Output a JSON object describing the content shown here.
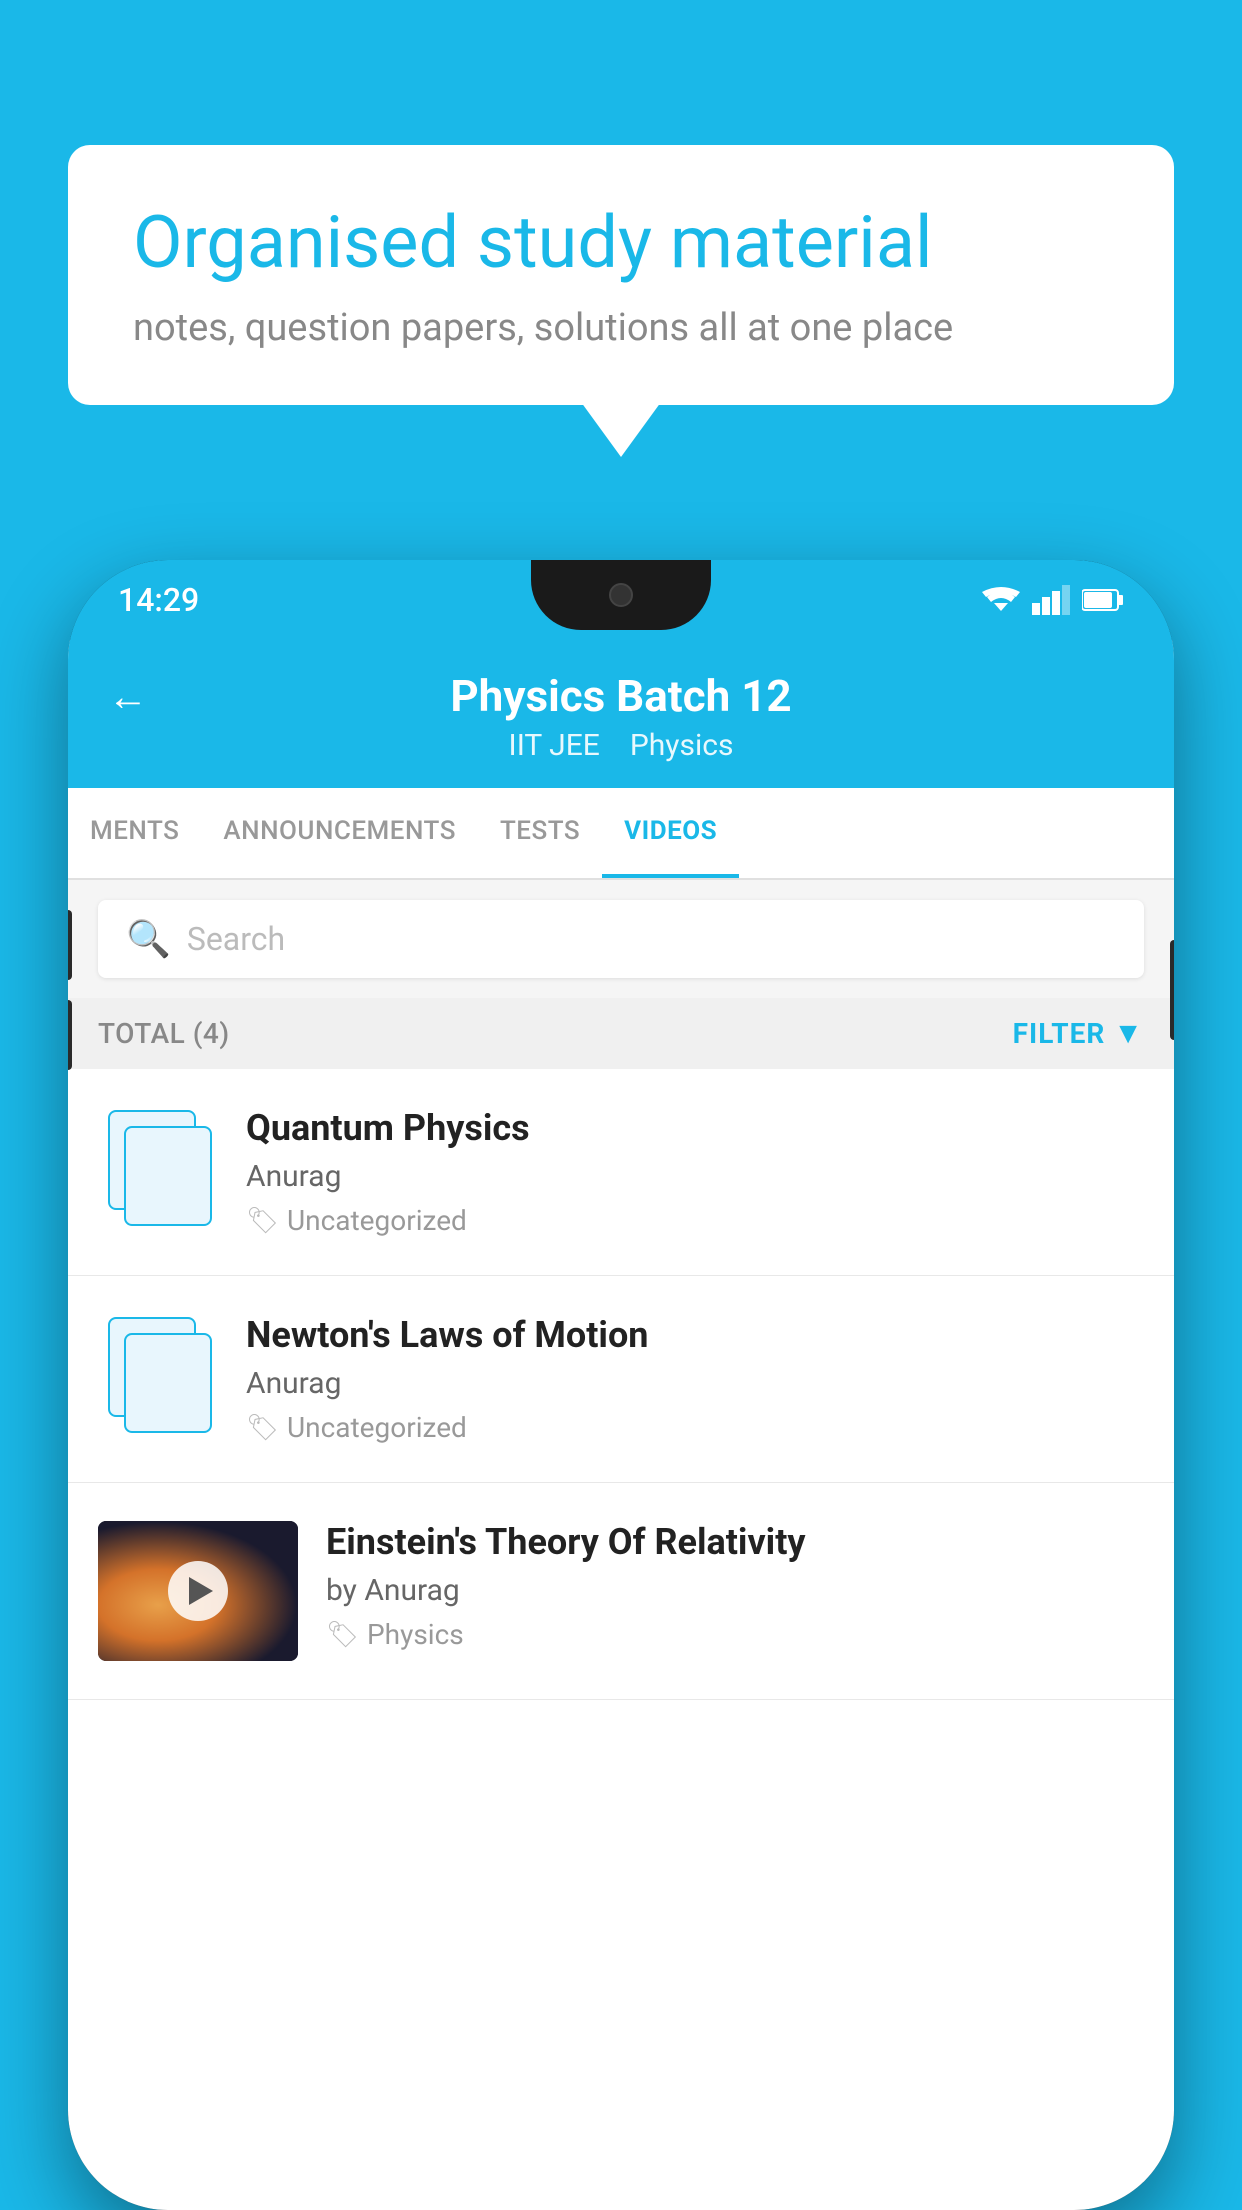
{
  "background": {
    "color": "#1ab8e8"
  },
  "speech_bubble": {
    "title": "Organised study material",
    "subtitle": "notes, question papers, solutions all at one place"
  },
  "phone": {
    "status_bar": {
      "time": "14:29"
    },
    "header": {
      "back_label": "←",
      "title": "Physics Batch 12",
      "tags": [
        "IIT JEE",
        "Physics"
      ]
    },
    "tabs": [
      {
        "label": "MENTS",
        "active": false
      },
      {
        "label": "ANNOUNCEMENTS",
        "active": false
      },
      {
        "label": "TESTS",
        "active": false
      },
      {
        "label": "VIDEOS",
        "active": true
      }
    ],
    "search": {
      "placeholder": "Search"
    },
    "filter_bar": {
      "total_label": "TOTAL (4)",
      "filter_label": "FILTER"
    },
    "videos": [
      {
        "id": 1,
        "title": "Quantum Physics",
        "author": "Anurag",
        "tag": "Uncategorized",
        "has_thumbnail": false
      },
      {
        "id": 2,
        "title": "Newton's Laws of Motion",
        "author": "Anurag",
        "tag": "Uncategorized",
        "has_thumbnail": false
      },
      {
        "id": 3,
        "title": "Einstein's Theory Of Relativity",
        "author": "by Anurag",
        "tag": "Physics",
        "has_thumbnail": true
      }
    ]
  }
}
